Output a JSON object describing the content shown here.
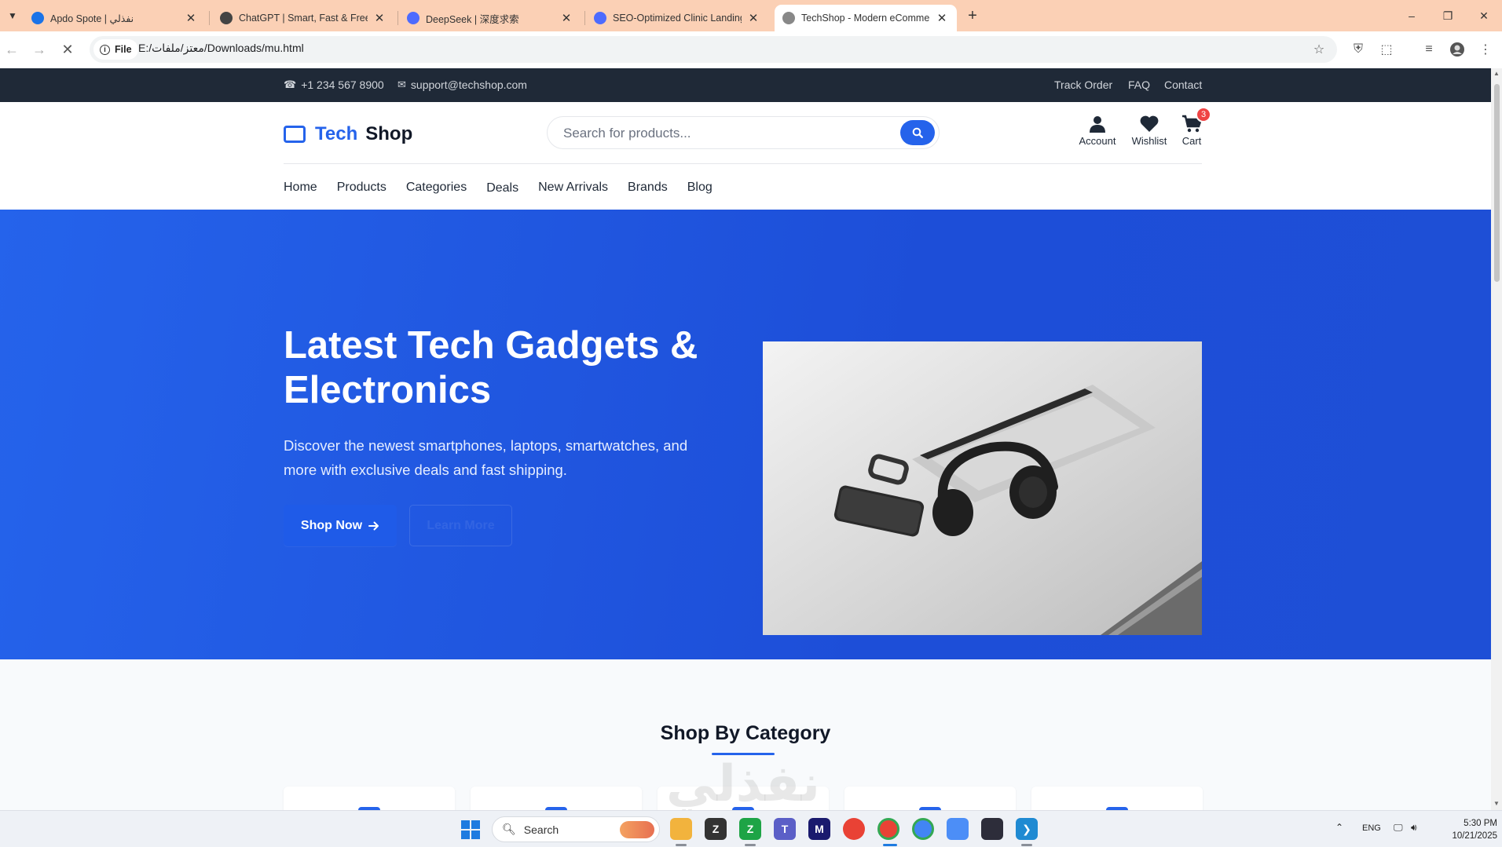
{
  "browser": {
    "tabs": [
      {
        "title": "Apdo Spote | نفذلي",
        "favicon_color": "#1a73e8"
      },
      {
        "title": "ChatGPT | Smart, Fast & Free AI",
        "favicon_color": "#444444"
      },
      {
        "title": "DeepSeek | 深度求索",
        "favicon_color": "#4d6bfe"
      },
      {
        "title": "SEO-Optimized Clinic Landing Page",
        "favicon_color": "#4d6bfe"
      },
      {
        "title": "TechShop - Modern eCommerce",
        "favicon_color": "#666666",
        "active": true
      }
    ],
    "address": {
      "chip_label": "File",
      "url": "E:/معتز/ملفات/Downloads/mu.html"
    }
  },
  "site": {
    "topbar": {
      "phone": "+1 234 567 8900",
      "email": "support@techshop.com",
      "links": [
        "Track Order",
        "FAQ",
        "Contact"
      ]
    },
    "logo": {
      "part1": "Tech",
      "part2": "Shop"
    },
    "search": {
      "placeholder": "Search for products..."
    },
    "header_icons": [
      {
        "label": "Account",
        "icon": "user-icon"
      },
      {
        "label": "Wishlist",
        "icon": "heart-icon"
      },
      {
        "label": "Cart",
        "icon": "cart-icon",
        "badge": "3"
      }
    ],
    "nav": [
      "Home",
      "Products",
      "Categories",
      "Deals",
      "New Arrivals",
      "Brands",
      "Blog"
    ],
    "hero": {
      "title": "Latest Tech Gadgets & Electronics",
      "subtitle": "Discover the newest smartphones, laptops, smartwatches, and more with exclusive deals and fast shipping.",
      "primary_button": "Shop Now",
      "secondary_button": "Learn More"
    },
    "categories_section": {
      "title": "Shop By Category"
    },
    "watermark": "نفذلي"
  },
  "taskbar": {
    "search_label": "Search",
    "tray": {
      "language": "ENG",
      "time": "5:30 PM",
      "date": "10/21/2025"
    }
  },
  "colors": {
    "brand": "#2563eb",
    "topbar_bg": "#1f2937",
    "tabbar_bg": "#fbd0b5",
    "badge": "#ef4444"
  }
}
